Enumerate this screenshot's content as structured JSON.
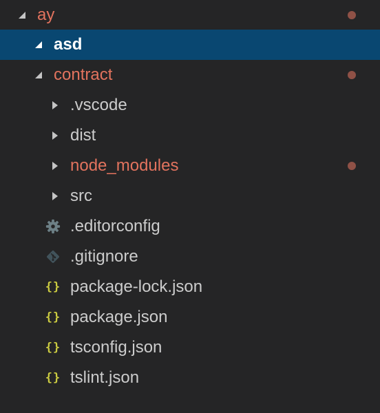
{
  "explorer": {
    "items": [
      {
        "label": "ay",
        "depth": 0,
        "type": "folder",
        "expanded": true,
        "modified": true,
        "selected": false
      },
      {
        "label": "asd",
        "depth": 1,
        "type": "folder",
        "expanded": true,
        "modified": false,
        "selected": true
      },
      {
        "label": "contract",
        "depth": 1,
        "type": "folder",
        "expanded": true,
        "modified": true,
        "selected": false
      },
      {
        "label": ".vscode",
        "depth": 2,
        "type": "folder",
        "expanded": false,
        "modified": false,
        "selected": false
      },
      {
        "label": "dist",
        "depth": 2,
        "type": "folder",
        "expanded": false,
        "modified": false,
        "selected": false
      },
      {
        "label": "node_modules",
        "depth": 2,
        "type": "folder",
        "expanded": false,
        "modified": true,
        "selected": false
      },
      {
        "label": "src",
        "depth": 2,
        "type": "folder",
        "expanded": false,
        "modified": false,
        "selected": false
      },
      {
        "label": ".editorconfig",
        "depth": 2,
        "type": "file",
        "icon": "gear-icon",
        "modified": false,
        "selected": false
      },
      {
        "label": ".gitignore",
        "depth": 2,
        "type": "file",
        "icon": "git-icon",
        "modified": false,
        "selected": false
      },
      {
        "label": "package-lock.json",
        "depth": 2,
        "type": "file",
        "icon": "json-braces-icon",
        "modified": false,
        "selected": false
      },
      {
        "label": "package.json",
        "depth": 2,
        "type": "file",
        "icon": "json-braces-icon",
        "modified": false,
        "selected": false
      },
      {
        "label": "tsconfig.json",
        "depth": 2,
        "type": "file",
        "icon": "json-braces-icon",
        "modified": false,
        "selected": false
      },
      {
        "label": "tslint.json",
        "depth": 2,
        "type": "file",
        "icon": "json-braces-icon",
        "modified": false,
        "selected": false
      }
    ]
  },
  "colors": {
    "background": "#252526",
    "selection": "#094771",
    "text": "#cccccc",
    "modified_text": "#e2735e",
    "modified_dot": "#8f5146",
    "json_icon": "#cbcb41",
    "gear_icon": "#6d8086",
    "git_icon": "#41535b"
  }
}
